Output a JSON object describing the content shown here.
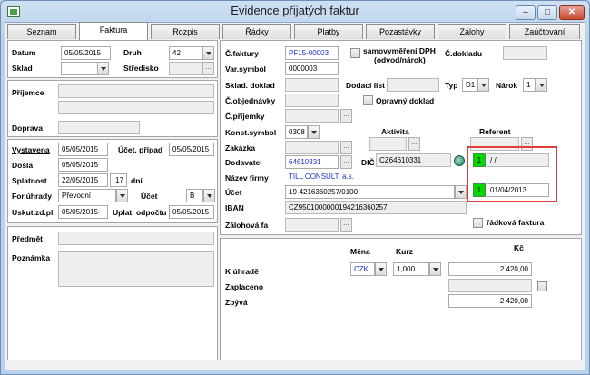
{
  "window": {
    "title": "Evidence přijatých faktur",
    "minimize": "–",
    "maximize": "□",
    "close": "✕"
  },
  "tabs": [
    {
      "label": "Seznam"
    },
    {
      "label": "Faktura"
    },
    {
      "label": "Rozpis"
    },
    {
      "label": "Řádky"
    },
    {
      "label": "Platby"
    },
    {
      "label": "Pozastávky"
    },
    {
      "label": "Zálohy"
    },
    {
      "label": "Zaúčtování"
    }
  ],
  "left": {
    "datum_label": "Datum",
    "datum_value": "05/05/2015",
    "druh_label": "Druh",
    "druh_value": "42",
    "sklad_label": "Sklad",
    "stredisko_label": "Středisko",
    "prijemce_label": "Příjemce",
    "doprava_label": "Doprava",
    "vystavena_label": "Vystavena",
    "vystavena_value": "05/05/2015",
    "ucet_pripad_label": "Účet. případ",
    "ucet_pripad_value": "05/05/2015",
    "dosla_label": "Došla",
    "dosla_value": "05/05/2015",
    "splatnost_label": "Splatnost",
    "splatnost_value": "22/05/2015",
    "splatnost_days": "17",
    "dni_label": "dní",
    "forma_label": "For.úhrady",
    "forma_value": "Převodní příkaz",
    "ucet_label": "Účet",
    "ucet_value": "B",
    "uskut_label": "Uskut.zd.pl.",
    "uskut_value": "05/05/2015",
    "uplat_label": "Uplat. odpočtu",
    "uplat_value": "05/05/2015",
    "predmet_label": "Předmět",
    "poznamka_label": "Poznámka"
  },
  "right": {
    "cfaktury_label": "Č.faktury",
    "cfaktury_value": "PF15-00003",
    "samovymereni_label": "samovyměření DPH",
    "samovymereni_sub": "(odvod/nárok)",
    "cdokladu_label": "Č.dokladu",
    "varsymbol_label": "Var.symbol",
    "varsymbol_value": "0000003",
    "sklad_doklad_label": "Sklad. doklad",
    "dodaci_list_label": "Dodací list",
    "typ_label": "Typ",
    "typ_value": "D1",
    "narok_label": "Nárok",
    "narok_value": "1",
    "cobjednavky_label": "Č.objednávky",
    "opravny_label": "Opravný doklad",
    "cprijemky_label": "Č.příjemky",
    "konst_label": "Konst.symbol",
    "konst_value": "0308",
    "aktivita_label": "Aktivita",
    "referent_label": "Referent",
    "zakazka_label": "Zakázka",
    "dodavatel_label": "Dodavatel",
    "dodavatel_value": "64610331",
    "dic_label": "DIČ",
    "dic_value": "CZ64610331",
    "green1": "1",
    "green1_text": "/ /",
    "nazev_label": "Název firmy",
    "nazev_value": "TILL CONSULT, a.s.",
    "ucet_label": "Účet",
    "ucet_value": "19-4216360257/0100",
    "green2": "1",
    "green2_text": "01/04/2013",
    "iban_label": "IBAN",
    "iban_value": "CZ9501000000194216360257",
    "zalohova_label": "Zálohová fa",
    "radkova_label": "řádková faktura"
  },
  "totals": {
    "mena_label": "Měna",
    "kurz_label": "Kurz",
    "kc_label": "Kč",
    "k_uhrade_label": "K úhradě",
    "mena_value": "CZK",
    "kurz_value": "1,000",
    "k_uhrade_value": "2 420,00",
    "zaplaceno_label": "Zaplaceno",
    "zbyva_label": "Zbývá",
    "zbyva_value": "2 420,00"
  },
  "colors": {
    "accent_green": "#00d800",
    "highlight_red": "#e23c3c",
    "link_blue": "#1f2fc7"
  }
}
